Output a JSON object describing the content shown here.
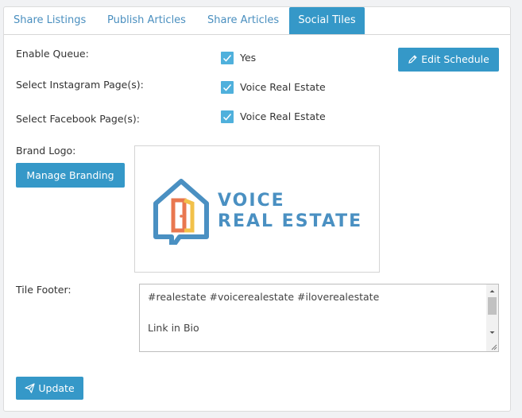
{
  "tabs": [
    {
      "label": "Share Listings",
      "active": false
    },
    {
      "label": "Publish Articles",
      "active": false
    },
    {
      "label": "Share Articles",
      "active": false
    },
    {
      "label": "Social Tiles",
      "active": true
    }
  ],
  "form": {
    "enable_queue_label": "Enable Queue:",
    "enable_queue_value": "Yes",
    "instagram_label": "Select Instagram Page(s):",
    "instagram_value": "Voice Real Estate",
    "facebook_label": "Select Facebook Page(s):",
    "facebook_value": "Voice Real Estate",
    "brand_logo_label": "Brand Logo:",
    "tile_footer_label": "Tile Footer:",
    "tile_footer_lines": [
      "#realestate #voicerealestate #iloverealestate",
      "",
      "Link in Bio",
      "",
      "..."
    ]
  },
  "buttons": {
    "edit_schedule": "Edit Schedule",
    "manage_branding": "Manage Branding",
    "update": "Update"
  },
  "logo": {
    "line1": "VOICE",
    "line2": "REAL ESTATE"
  },
  "colors": {
    "accent": "#3598c8",
    "checkbox": "#4fb0dc",
    "tab_text": "#4a8fbf",
    "logo_blue": "#4a90c2",
    "logo_orange": "#e9774f",
    "logo_yellow": "#f2c14a"
  },
  "icons": {
    "edit_schedule": "pencil-icon",
    "update": "paper-plane-icon",
    "checkbox": "checkmark-icon"
  }
}
